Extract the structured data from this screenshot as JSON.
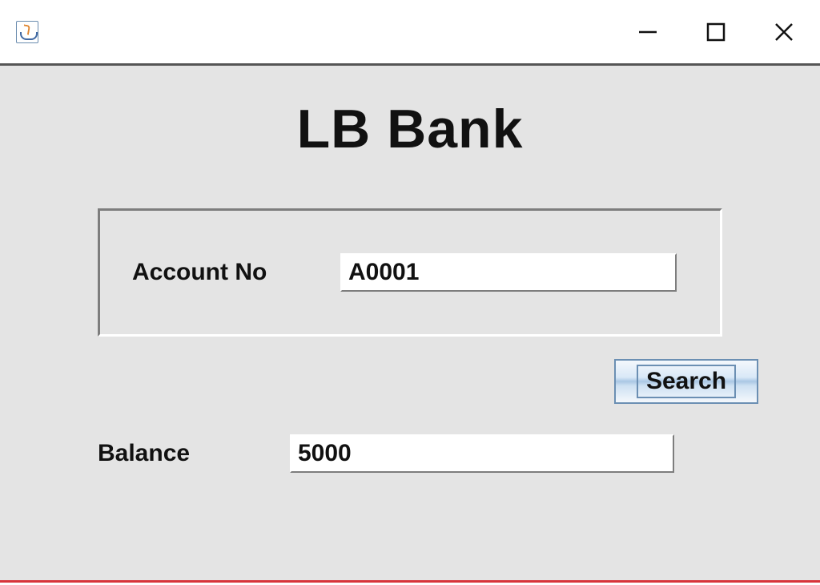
{
  "window": {
    "title": ""
  },
  "app": {
    "title": "LB Bank"
  },
  "form": {
    "accountNo": {
      "label": "Account No",
      "value": "A0001"
    },
    "searchButton": "Search",
    "balance": {
      "label": "Balance",
      "value": "5000"
    }
  }
}
